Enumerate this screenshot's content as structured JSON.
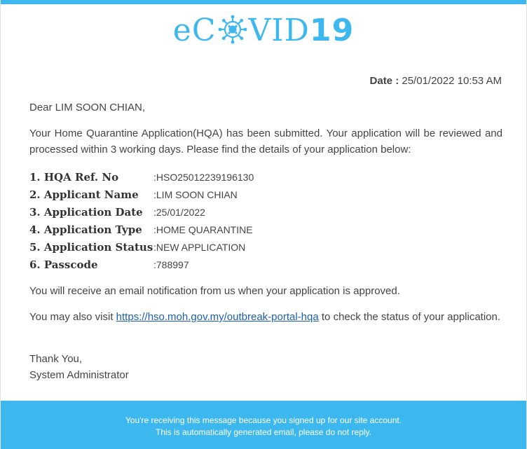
{
  "brand": {
    "prefix": "eC",
    "suffix": "VID",
    "number": "19",
    "color": "#3db8ee"
  },
  "header": {
    "date_label": "Date :",
    "date_value": "25/01/2022 10:53 AM"
  },
  "greeting": "Dear LIM SOON CHIAN,",
  "intro": "Your Home Quarantine Application(HQA) has been submitted. Your application will be reviewed and processed within 3 working days. Please find the details of your application below:",
  "details": [
    {
      "label": "1. HQA Ref. No",
      "value": "HSO25012239196130"
    },
    {
      "label": "2. Applicant Name",
      "value": "LIM SOON CHIAN"
    },
    {
      "label": "3. Application Date",
      "value": "25/01/2022"
    },
    {
      "label": "4. Application Type",
      "value": "HOME QUARANTINE"
    },
    {
      "label": "5. Application Status",
      "value": "NEW APPLICATION"
    },
    {
      "label": "6. Passcode",
      "value": "788997"
    }
  ],
  "separator": ":",
  "notice": "You will receive an email notification from us when your application is approved.",
  "visit": {
    "before": "You may also visit ",
    "link_text": "https://hso.moh.gov.my/outbreak-portal-hqa",
    "after": " to check the status of your application."
  },
  "signoff": {
    "thanks": "Thank You,",
    "sender": "System Administrator"
  },
  "footer": {
    "line1": "You're receiving this message because you signed up for our site account.",
    "line2": "This is automatically generated email, please do not reply."
  },
  "colors": {
    "accent": "#3db8ee",
    "link": "#1a5fb4"
  },
  "icons": {
    "logo_o": "virus-icon"
  }
}
